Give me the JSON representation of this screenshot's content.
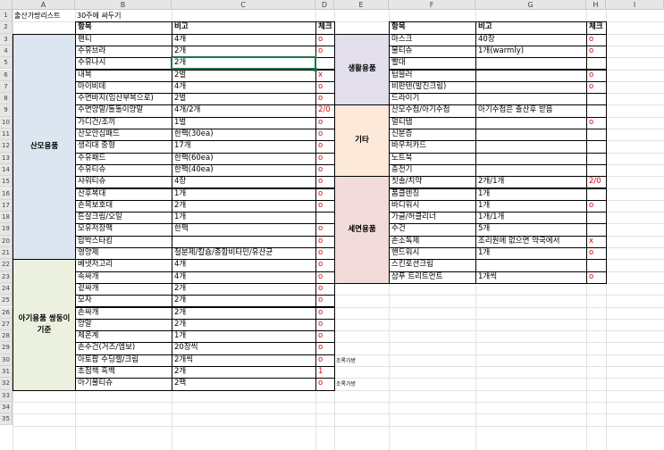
{
  "columns": [
    "A",
    "B",
    "C",
    "D",
    "E",
    "F",
    "G",
    "H",
    "I"
  ],
  "rows": [
    "1",
    "2",
    "3",
    "4",
    "5",
    "6",
    "7",
    "8",
    "9",
    "10",
    "11",
    "12",
    "13",
    "14",
    "15",
    "16",
    "17",
    "18",
    "19",
    "20",
    "21",
    "22",
    "23",
    "24",
    "25",
    "26",
    "27",
    "28",
    "29",
    "30",
    "31",
    "32",
    "33",
    "34",
    "35"
  ],
  "title": "출산가방리스트",
  "subtitle": "30주에 싸두기",
  "colors": {
    "sanmo": "#dce6f1",
    "baby": "#ebf1de",
    "life": "#e4dfec",
    "etc": "#fde9d9",
    "wash": "#f2dcdb",
    "red": "#e00000"
  },
  "left": {
    "headers": {
      "item": "항목",
      "note": "비고",
      "check": "체크"
    },
    "categories": [
      {
        "label": "산모용품"
      },
      {
        "label": "아기용품\n쌍둥이기준"
      }
    ],
    "items": [
      {
        "item": "팬티",
        "note": "4개",
        "check": "o"
      },
      {
        "item": "수유브라",
        "note": "2개",
        "check": "o"
      },
      {
        "item": "수유나시",
        "note": "2개",
        "check": ""
      },
      {
        "item": "내복",
        "note": "2벌",
        "check": "x"
      },
      {
        "item": "마이비데",
        "note": "4개",
        "check": "o"
      },
      {
        "item": "수면바지(임산부복으로)",
        "note": "2벌",
        "check": "o"
      },
      {
        "item": "수면양말/돌돌이양말",
        "note": "4개/2개",
        "check": "2/0"
      },
      {
        "item": "가디건/조끼",
        "note": "1벌",
        "check": "o"
      },
      {
        "item": "산모안심패드",
        "note": "한팩(30ea)",
        "check": "o"
      },
      {
        "item": "생리대 중형",
        "note": "17개",
        "check": "o"
      },
      {
        "item": "수유패드",
        "note": "한팩(60ea)",
        "check": "o"
      },
      {
        "item": "수유티슈",
        "note": "한팩(40ea)",
        "check": "o"
      },
      {
        "item": "샤워티슈",
        "note": "4장",
        "check": "o"
      },
      {
        "item": "산후복대",
        "note": "1개",
        "check": "o"
      },
      {
        "item": "손목보호대",
        "note": "2개",
        "check": "o"
      },
      {
        "item": "튼살크림/오일",
        "note": "1개",
        "check": ""
      },
      {
        "item": "모유저장팩",
        "note": "한팩",
        "check": "o"
      },
      {
        "item": "압박스타킹",
        "note": "",
        "check": "o"
      },
      {
        "item": "영양제",
        "note": "철분제/칼슘/종합비타민/유산균",
        "check": "o"
      },
      {
        "item": "베냇저고리",
        "note": "4개",
        "check": "o"
      },
      {
        "item": "속싸개",
        "note": "4개",
        "check": "o"
      },
      {
        "item": "겉싸개",
        "note": "2개",
        "check": "o"
      },
      {
        "item": "모자",
        "note": "2개",
        "check": "o"
      },
      {
        "item": "손싸개",
        "note": "2개",
        "check": "o"
      },
      {
        "item": "양말",
        "note": "2개",
        "check": "o"
      },
      {
        "item": "체온계",
        "note": "1개",
        "check": "o"
      },
      {
        "item": "손수건(거즈/엠보)",
        "note": "20장씩",
        "check": "o"
      },
      {
        "item": "아토팜 수딩젤/크림",
        "note": "2개씩",
        "check": "o"
      },
      {
        "item": "초점책 흑백",
        "note": "2개",
        "check": "1"
      },
      {
        "item": "아기물티슈",
        "note": "2팩",
        "check": "o"
      }
    ],
    "side_notes": {
      "row30": "조록가방",
      "row32": "조록가방"
    }
  },
  "right": {
    "headers": {
      "item": "항목",
      "note": "비고",
      "check": "체크"
    },
    "categories": [
      {
        "label": "생활용품"
      },
      {
        "label": "기타"
      },
      {
        "label": "세면용품"
      }
    ],
    "items": [
      {
        "item": "마스크",
        "note": "40장",
        "check": "o"
      },
      {
        "item": "물티슈",
        "note": "1개(warmly)",
        "check": "o"
      },
      {
        "item": "빨대",
        "note": "",
        "check": ""
      },
      {
        "item": "텀블러",
        "note": "",
        "check": "o"
      },
      {
        "item": "비판텐(발진크림)",
        "note": "",
        "check": "o"
      },
      {
        "item": "드라이기",
        "note": "",
        "check": ""
      },
      {
        "item": "산모수첩/아기수첩",
        "note": "아기수첩은 출산후 받음",
        "check": ""
      },
      {
        "item": "멀티탭",
        "note": "",
        "check": "o"
      },
      {
        "item": "신분증",
        "note": "",
        "check": ""
      },
      {
        "item": "바우처카드",
        "note": "",
        "check": ""
      },
      {
        "item": "노트북",
        "note": "",
        "check": ""
      },
      {
        "item": "충전기",
        "note": "",
        "check": ""
      },
      {
        "item": "칫솔/치약",
        "note": "2개/1개",
        "check": "2/0"
      },
      {
        "item": "폼클렌징",
        "note": "1개",
        "check": ""
      },
      {
        "item": "바디워시",
        "note": "1개",
        "check": "o"
      },
      {
        "item": "가글/허클리너",
        "note": "1개/1개",
        "check": ""
      },
      {
        "item": "수건",
        "note": "5개",
        "check": ""
      },
      {
        "item": "손소독제",
        "note": "조리원에 없으면 약국에서",
        "check": "x"
      },
      {
        "item": "핸드워시",
        "note": "1개",
        "check": "o"
      },
      {
        "item": "스킨로션크림",
        "note": "",
        "check": ""
      },
      {
        "item": "샴푸 트리트먼트",
        "note": "1개씩",
        "check": "o"
      }
    ]
  }
}
